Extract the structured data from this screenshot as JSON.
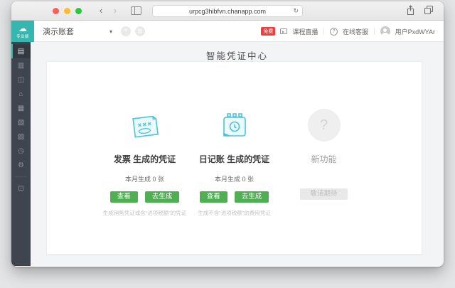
{
  "browser": {
    "url": "urpcg3hibfvn.chanapp.com",
    "back_glyph": "‹",
    "forward_glyph": "›",
    "reload_glyph": "↻"
  },
  "app_header": {
    "logo_cloud_glyph": "☁",
    "logo_edition": "专业版",
    "account_name": "演示账套",
    "caret_glyph": "▾",
    "add_glyph": "+",
    "grid_glyph": "⊞",
    "hot_badge": "免费",
    "live_label": "课程直播",
    "support_label": "在线客服",
    "user_label": "用户PxdWYAr",
    "divider_glyph": "|",
    "question_glyph": "?"
  },
  "sidebar": {
    "items": [
      {
        "name": "voucher",
        "glyph": "▤"
      },
      {
        "name": "account-book",
        "glyph": "▥"
      },
      {
        "name": "report",
        "glyph": "◫"
      },
      {
        "name": "asset",
        "glyph": "⌂"
      },
      {
        "name": "fund",
        "glyph": "▦"
      },
      {
        "name": "invoice",
        "glyph": "▧"
      },
      {
        "name": "salary",
        "glyph": "▨"
      },
      {
        "name": "checkout",
        "glyph": "◷"
      },
      {
        "name": "settings",
        "glyph": "⚙"
      }
    ],
    "bottom_item": {
      "name": "more-apps",
      "glyph": "⊡"
    }
  },
  "main": {
    "title": "智能凭证中心",
    "cards": [
      {
        "title": "发票 生成的凭证",
        "subtitle": "本月生成 0 张",
        "view_label": "查看",
        "generate_label": "去生成",
        "note": "生成销售凭证或含“进项税额”的凭证"
      },
      {
        "title": "日记账 生成的凭证",
        "subtitle": "本月生成 0 张",
        "view_label": "查看",
        "generate_label": "去生成",
        "note": "生成不含“进项税额”的费用凭证"
      },
      {
        "title": "新功能",
        "question_glyph": "?",
        "button_label": "敬请期待"
      }
    ]
  },
  "colors": {
    "accent_teal": "#35b6ae",
    "button_green": "#4eb052",
    "badge_red": "#f43b3b",
    "sidebar_dark": "#3e454e"
  }
}
